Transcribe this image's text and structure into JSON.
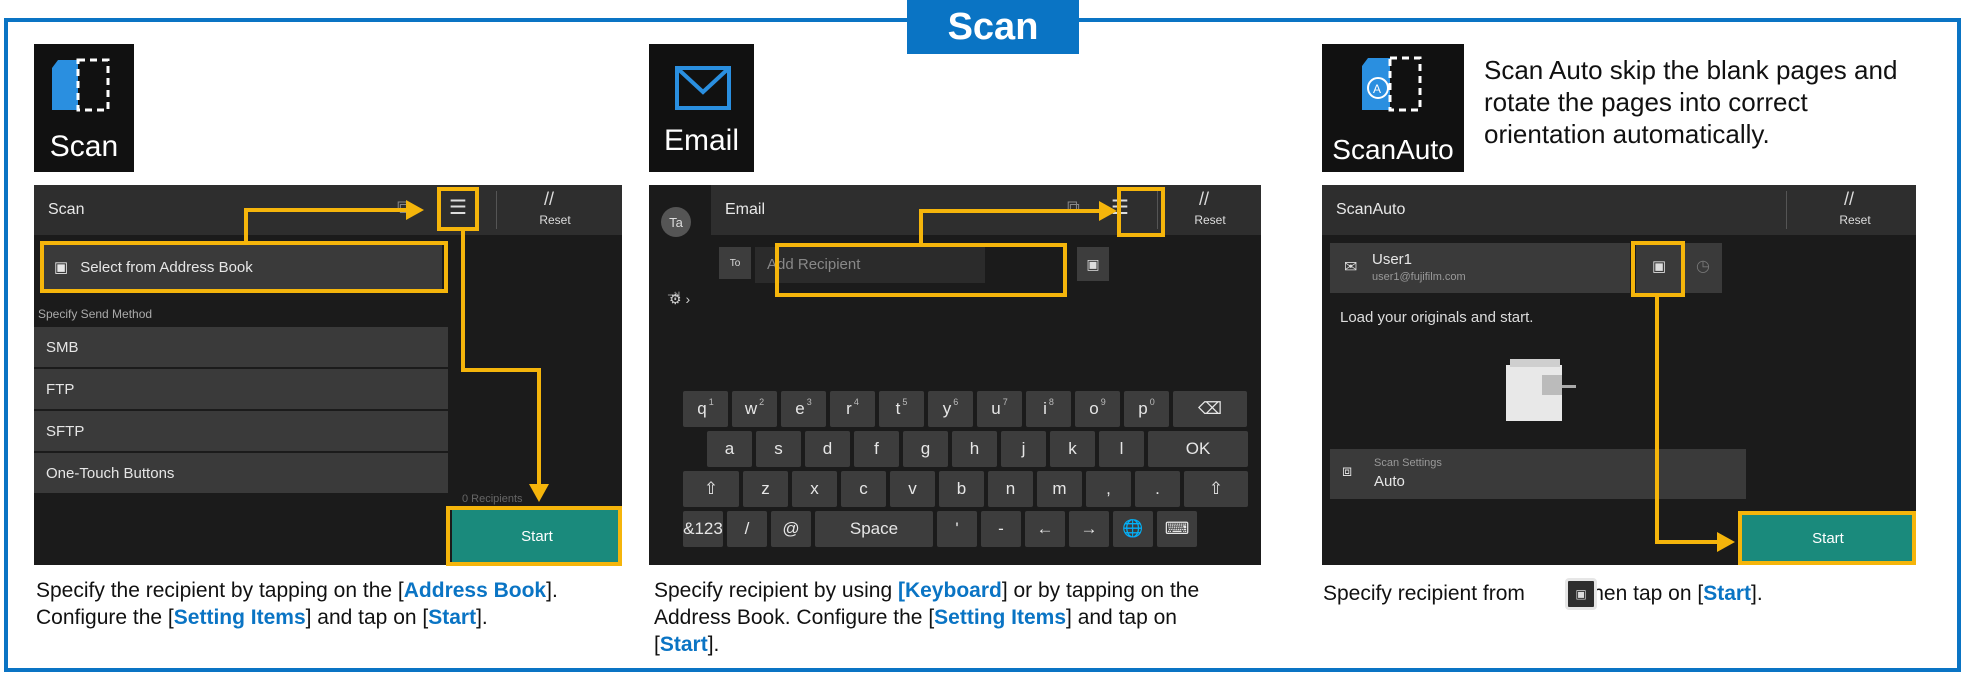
{
  "title": "Scan",
  "panel1": {
    "app_label": "Scan",
    "header": "Scan",
    "reset": "Reset",
    "address_book": "Select from Address Book",
    "section": "Specify Send Method",
    "methods": [
      "SMB",
      "FTP",
      "SFTP",
      "One-Touch Buttons"
    ],
    "recipients": "0 Recipients",
    "start": "Start",
    "caption_a": "Specify the recipient by tapping on the [",
    "caption_b": "Address Book",
    "caption_c": "].",
    "caption_d": "Configure the [",
    "caption_e": "Setting Items",
    "caption_f": "] and tap on [",
    "caption_g": "Start",
    "caption_h": "]."
  },
  "panel2": {
    "app_label": "Email",
    "avatar": "Ta",
    "header": "Email",
    "reset": "Reset",
    "to": "To",
    "add_recipient": "Add Recipient",
    "row1": [
      "q",
      "w",
      "e",
      "r",
      "t",
      "y",
      "u",
      "i",
      "o",
      "p"
    ],
    "row1_sup": [
      "1",
      "2",
      "3",
      "4",
      "5",
      "6",
      "7",
      "8",
      "9",
      "0"
    ],
    "row2": [
      "a",
      "s",
      "d",
      "f",
      "g",
      "h",
      "j",
      "k",
      "l"
    ],
    "ok": "OK",
    "row3": [
      "z",
      "x",
      "c",
      "v",
      "b",
      "n",
      "m",
      ",",
      "."
    ],
    "space": "Space",
    "key_123": "&123",
    "key_slash": "/",
    "key_at": "@",
    "key_apos": "'",
    "key_dash": "-",
    "caption_a": "Specify recipient by using ",
    "caption_b": "[Keyboard",
    "caption_c": "] or by tapping on the",
    "caption_d": "Address Book. Configure the [",
    "caption_e": "Setting Items",
    "caption_f": "] and tap on",
    "caption_g": "[",
    "caption_h": "Start",
    "caption_i": "]."
  },
  "panel3": {
    "app_label": "ScanAuto",
    "description": "Scan Auto skip the blank pages and rotate the pages into correct orientation automatically.",
    "header": "ScanAuto",
    "reset": "Reset",
    "user": "User1",
    "email": "user1@fujifilm.com",
    "load_msg": "Load your originals and start.",
    "settings_label": "Scan Settings",
    "settings_value": "Auto",
    "start": "Start",
    "caption_a": "Specify recipient from ",
    "caption_b": ", then tap on [",
    "caption_c": "Start",
    "caption_d": "]."
  },
  "colors": {
    "accent": "#0a74c4",
    "highlight": "#f5b50b",
    "start": "#1a8a7c"
  }
}
